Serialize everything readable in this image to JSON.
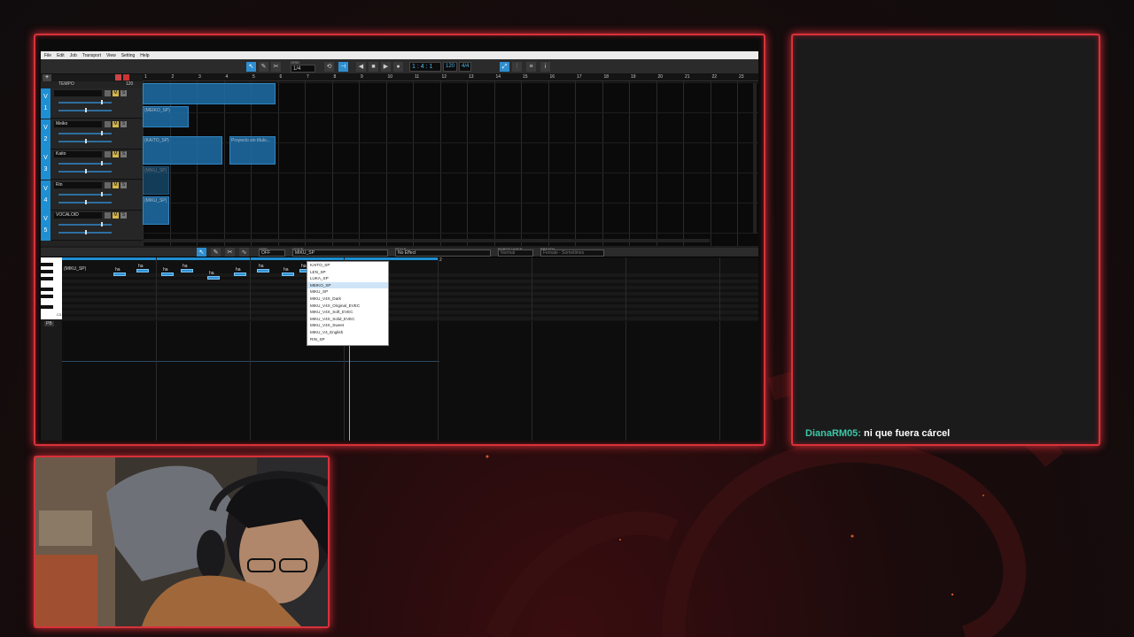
{
  "menubar": [
    "File",
    "Edit",
    "Job",
    "Transport",
    "View",
    "Setting",
    "Help"
  ],
  "toolbar": {
    "grid_label": "GRID",
    "grid_value": "1/4",
    "position": "1 : 4 : 1",
    "tempo": "120",
    "time_sig": "4/4"
  },
  "tracks": {
    "tempo_label": "TEMPO",
    "tempo_value": "120",
    "items": [
      {
        "num": "1",
        "name": "",
        "v": "V"
      },
      {
        "num": "2",
        "name": "Meiko",
        "v": "V"
      },
      {
        "num": "3",
        "name": "Kaito",
        "v": "V"
      },
      {
        "num": "4",
        "name": "Rin",
        "v": "V"
      },
      {
        "num": "5",
        "name": "VOCALOID",
        "v": "V"
      }
    ],
    "m_label": "M",
    "s_label": "S"
  },
  "arrange": {
    "ruler": [
      "1",
      "2",
      "3",
      "4",
      "5",
      "6",
      "7",
      "8",
      "9",
      "10",
      "11",
      "12",
      "13",
      "14",
      "15",
      "16",
      "17",
      "18",
      "19",
      "20",
      "21",
      "22",
      "23"
    ],
    "clips": [
      "(MEIKO_SP)",
      "(KAITO_SP)",
      "Proyecto sin título...",
      "(MIKU_SP)",
      "(MIKU_SP)"
    ]
  },
  "lower_toolbar": {
    "grid_label": "GRID",
    "grid_value": "OFF",
    "voice_label": "VOICE",
    "voice_value": "MIKU_SP",
    "style_label": "STYLE",
    "style_value": "No Effect",
    "robot_label": "ROBOT VOICE",
    "robot_value": "Normal",
    "breath_label": "BREATH",
    "breath_value": "Female - Sometimes"
  },
  "piano_roll": {
    "part_name": "(MIKU_SP)",
    "ruler_mark": "2",
    "c_label": "C3",
    "lyrics": [
      "ha",
      "ha",
      "ha",
      "ha",
      "ha",
      "ha",
      "ha",
      "ha",
      "ha",
      "ha"
    ]
  },
  "pb_label": "PB",
  "voice_menu": [
    "KAITO_SP",
    "LEN_SP",
    "LUKA_SP",
    "MEIKO_SP",
    "MIKU_SP",
    "MIKU_V4X_Dark",
    "MIKU_V4X_Original_EVEC",
    "MIKU_V4X_Soft_EVEC",
    "MIKU_V4X_Solid_EVEC",
    "MIKU_V4X_Sweet",
    "MIKU_V4_English",
    "RIN_SP"
  ],
  "voice_menu_selected": 3,
  "chat": {
    "user": "DianaRM05:",
    "message": " ni que fuera cárcel"
  },
  "colors": {
    "accent": "#d8323a",
    "clip": "#1d6ea8",
    "track": "#1e8fd3",
    "chat_user": "#3ec6a6"
  }
}
